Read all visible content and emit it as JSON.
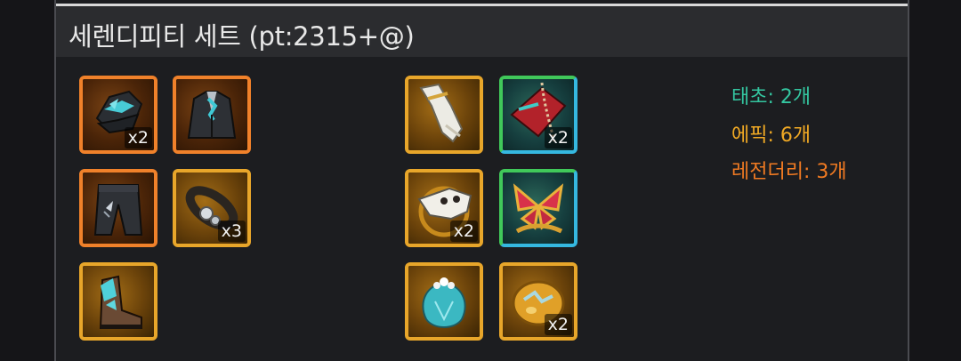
{
  "title": "세렌디피티 세트 (pt:2315+@)",
  "colors": {
    "legendary": "#f0812a",
    "epic": "#e8a62a",
    "primeval_top": "#40c85a",
    "primeval_bottom": "#35b8e0",
    "summary_primeval": "#34c6a0",
    "summary_epic": "#f0a924",
    "summary_legendary": "#f07a22"
  },
  "left_items": [
    {
      "icon": "hat-icon",
      "rarity": "legendary",
      "count": "x2"
    },
    {
      "icon": "jacket-icon",
      "rarity": "legendary",
      "count": ""
    },
    {
      "icon": "pants-icon",
      "rarity": "legendary",
      "count": ""
    },
    {
      "icon": "belt-icon",
      "rarity": "epic",
      "count": "x3"
    },
    {
      "icon": "boots-icon",
      "rarity": "epic",
      "count": ""
    }
  ],
  "right_items": [
    {
      "icon": "bracelet-icon",
      "rarity": "epic",
      "count": ""
    },
    {
      "icon": "necklace-icon",
      "rarity": "primeval",
      "count": "x2"
    },
    {
      "icon": "skull-ring-icon",
      "rarity": "epic",
      "count": "x2"
    },
    {
      "icon": "butterfly-icon",
      "rarity": "primeval",
      "count": ""
    },
    {
      "icon": "flower-stone-icon",
      "rarity": "epic",
      "count": ""
    },
    {
      "icon": "egg-icon",
      "rarity": "epic",
      "count": "x2"
    }
  ],
  "summary": {
    "primeval": "태초: 2개",
    "epic": "에픽: 6개",
    "legendary": "레전더리: 3개"
  }
}
